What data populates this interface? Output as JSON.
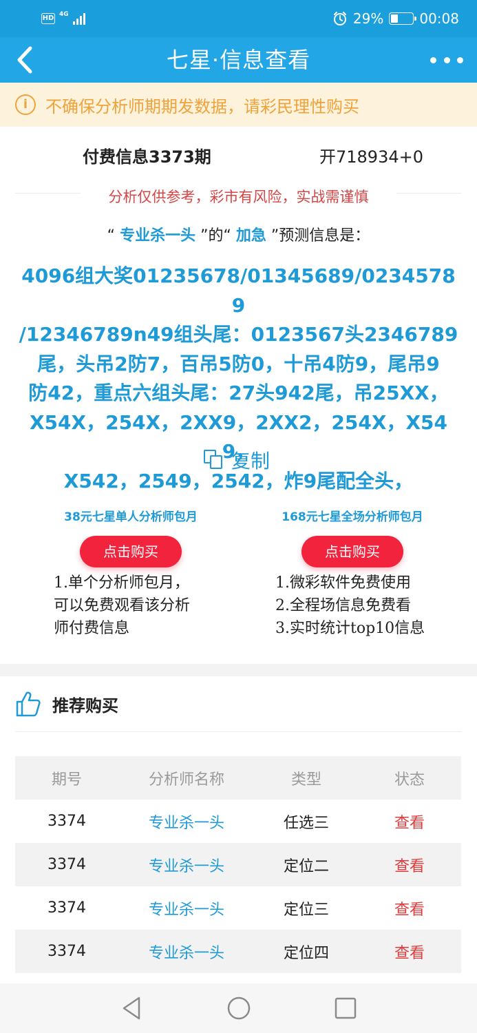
{
  "status_bar": {
    "hd": "HD",
    "network": "4G",
    "battery": "29%",
    "battery_level": 0.29,
    "time": "00:08",
    "icons": [
      "hd-icon",
      "signal-icon",
      "alarm-icon",
      "battery-icon"
    ]
  },
  "nav": {
    "title": "七星·信息查看",
    "back_icon": "chevron-left-icon",
    "more_icon": "more-dots-icon"
  },
  "notice": {
    "icon": "info-icon",
    "text": "不确保分析师期期发数据，请彩民理性购买"
  },
  "paid": {
    "period_title": "付费信息3373期",
    "result": "开718934+0"
  },
  "warning": "分析仅供参考，彩市有风险，实战需谨慎",
  "prediction": {
    "q_open": "“",
    "analyst": "专业杀一头",
    "mid": "”的“",
    "label": "加急",
    "tail": "”预测信息是：",
    "lines": [
      "4096组大奖01235678/01345689/02345789",
      "/12346789n49组头尾：0123567头2346789",
      "尾，头吊2防7，百吊5防0，十吊4防9，尾吊9",
      "防42，重点六组头尾：27头942尾，吊25XX，",
      "X54X，254X，2XX9，2XX2，254X，X549，",
      "X542，2549，2542，炸9尾配全头，"
    ]
  },
  "copy": {
    "label": "复制",
    "icon": "copy-icon"
  },
  "packages": [
    {
      "title": "38元七星单人分析师包月",
      "button": "点击购买",
      "desc": [
        "1.单个分析师包月，",
        "可以免费观看该分析",
        "师付费信息"
      ]
    },
    {
      "title": "168元七星全场分析师包月",
      "button": "点击购买",
      "desc": [
        "1.微彩软件免费使用",
        "2.全程场信息免费看",
        "3.实时统计top10信息"
      ]
    }
  ],
  "recommend": {
    "icon": "thumbs-up-icon",
    "title": "推荐购买",
    "columns": [
      "期号",
      "分析师名称",
      "类型",
      "状态"
    ],
    "rows": [
      {
        "period": "3374",
        "analyst": "专业杀一头",
        "type": "任选三",
        "status": "查看"
      },
      {
        "period": "3374",
        "analyst": "专业杀一头",
        "type": "定位二",
        "status": "查看"
      },
      {
        "period": "3374",
        "analyst": "专业杀一头",
        "type": "定位三",
        "status": "查看"
      },
      {
        "period": "3374",
        "analyst": "专业杀一头",
        "type": "定位四",
        "status": "查看"
      }
    ]
  },
  "system_nav": {
    "icons": [
      "back-triangle-icon",
      "home-circle-icon",
      "recent-square-icon"
    ]
  },
  "colors": {
    "primary": "#23a6e6",
    "accent_text": "#1e9ad6",
    "notice_bg": "#fdf3dc",
    "notice_text": "#f0a23a",
    "warning_text": "#d64545",
    "buy_button": "#f2233d",
    "status_text": "#e23b3b"
  }
}
